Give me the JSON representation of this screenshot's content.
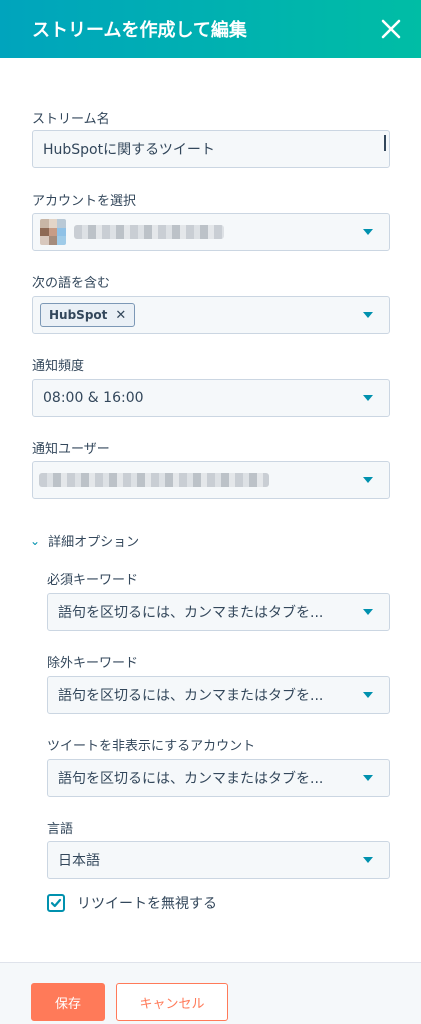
{
  "header": {
    "title": "ストリームを作成して編集"
  },
  "stream_name": {
    "label": "ストリーム名",
    "value": "HubSpotに関するツイート"
  },
  "account": {
    "label": "アカウントを選択"
  },
  "keywords": {
    "label": "次の語を含む",
    "tag": "HubSpot",
    "remove_symbol": "✕"
  },
  "frequency": {
    "label": "通知頻度",
    "value": "08:00 & 16:00"
  },
  "notify_user": {
    "label": "通知ユーザー"
  },
  "advanced": {
    "toggle_label": "詳細オプション",
    "required_keywords": {
      "label": "必須キーワード",
      "placeholder": "語句を区切るには、カンマまたはタブを..."
    },
    "excluded_keywords": {
      "label": "除外キーワード",
      "placeholder": "語句を区切るには、カンマまたはタブを..."
    },
    "hidden_accounts": {
      "label": "ツイートを非表示にするアカウント",
      "placeholder": "語句を区切るには、カンマまたはタブを..."
    },
    "language": {
      "label": "言語",
      "value": "日本語"
    },
    "ignore_retweets": {
      "label": "リツイートを無視する",
      "checked": true
    }
  },
  "footer": {
    "save_label": "保存",
    "cancel_label": "キャンセル"
  },
  "colors": {
    "header_start": "#00a4bd",
    "header_end": "#00bda5",
    "accent": "#0091ae",
    "primary_button": "#ff7a59",
    "text": "#33475b"
  }
}
